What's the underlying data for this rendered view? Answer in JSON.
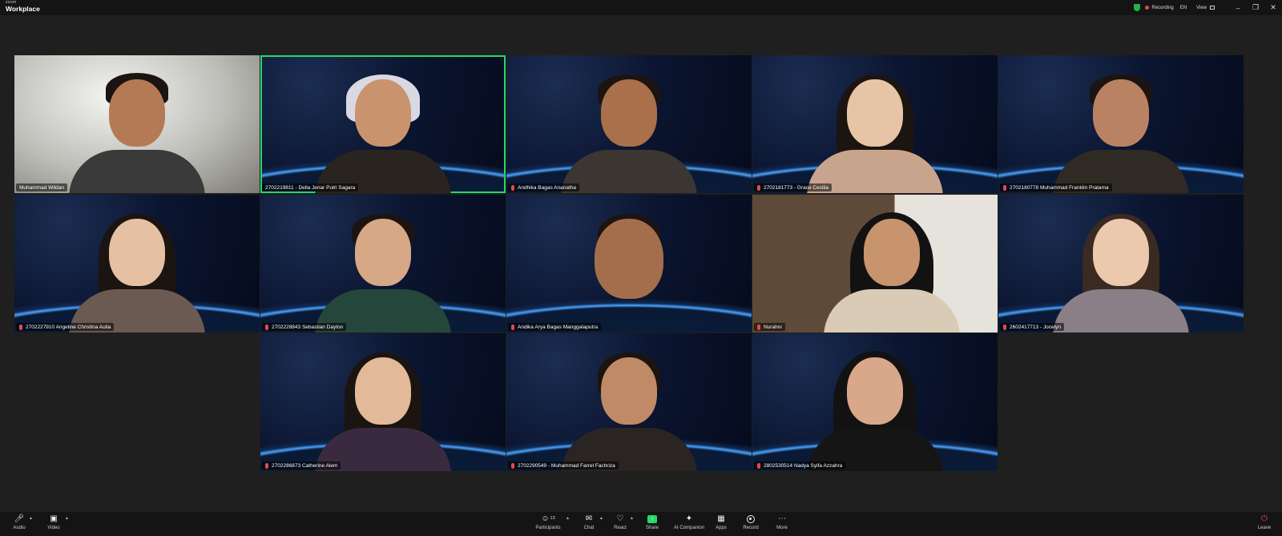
{
  "app": {
    "logo_small": "zoom",
    "logo_main": "Workplace"
  },
  "titlebar": {
    "recording_label": "Recording",
    "language": "EN",
    "view_label": "View",
    "minimize": "–",
    "restore": "❐",
    "close": "✕"
  },
  "participants": [
    {
      "name": "Muhammad Wildan",
      "muted": false
    },
    {
      "name": "2702219811 - Della Jenar Putri Sagara",
      "muted": false
    },
    {
      "name": "Andhika Bagas Ananatha",
      "muted": true
    },
    {
      "name": "2702181773 - Grace Cecilia",
      "muted": true
    },
    {
      "name": "2702180778 Muhammad Franklin Pratama",
      "muted": true
    },
    {
      "name": "2702227910 Angeline Christina Aulia",
      "muted": true
    },
    {
      "name": "2702228843 Sebastian Dayton",
      "muted": true
    },
    {
      "name": "Andika Arya Bagas Manggalaputra",
      "muted": true
    },
    {
      "name": "Nurahni",
      "muted": true
    },
    {
      "name": "2602417713 - Jocelyn",
      "muted": true
    },
    {
      "name": "2702286873 Catherine Alem",
      "muted": true
    },
    {
      "name": "2702290549 - Muhammad Farrel Fachriza",
      "muted": true
    },
    {
      "name": "2802530514 Nadya Syifa Azzahra",
      "muted": true
    }
  ],
  "toolbar": {
    "audio": "Audio",
    "video": "Video",
    "participants": "Participants",
    "participants_count": "13",
    "chat": "Chat",
    "react": "React",
    "share": "Share",
    "ai_companion": "AI Companion",
    "apps": "Apps",
    "record": "Record",
    "more": "More",
    "leave": "Leave"
  },
  "colors": {
    "active_speaker": "#23d96b",
    "share": "#23d96b",
    "mute": "#e5484d",
    "recording": "#e5484d"
  },
  "icons": [
    "mic-icon",
    "video-camera-icon",
    "participants-icon",
    "chat-icon",
    "react-icon",
    "share-icon",
    "ai-companion-icon",
    "apps-icon",
    "record-icon",
    "more-icon",
    "leave-icon",
    "shield-icon",
    "grid-view-icon"
  ]
}
